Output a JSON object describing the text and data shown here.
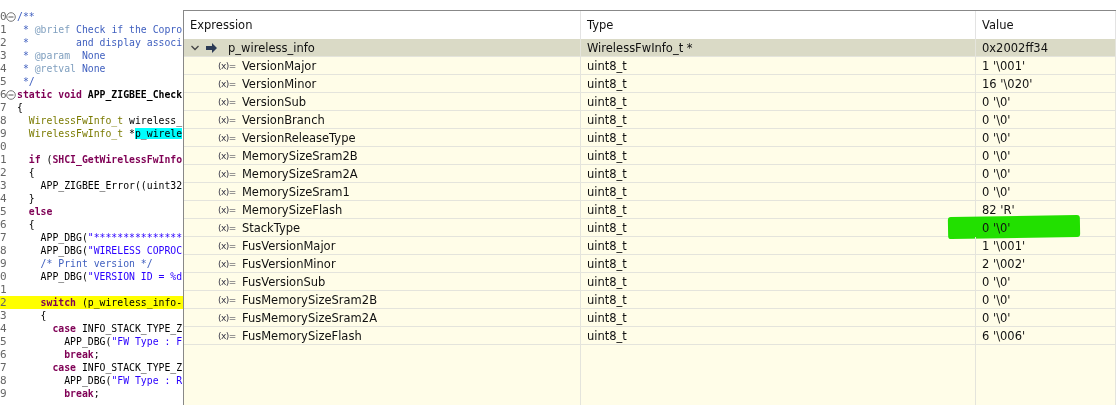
{
  "editor": {
    "lines": [
      {
        "number": "0",
        "folded": true,
        "highlighted": false,
        "segments": [
          {
            "kind": "comment",
            "text": "/**"
          }
        ]
      },
      {
        "number": "1",
        "folded": false,
        "highlighted": false,
        "segments": [
          {
            "kind": "comment",
            "text": " * "
          },
          {
            "kind": "tag",
            "text": "@brief"
          },
          {
            "kind": "comment",
            "text": " Check if the Copro"
          }
        ]
      },
      {
        "number": "2",
        "folded": false,
        "highlighted": false,
        "segments": [
          {
            "kind": "comment",
            "text": " *        and display associ"
          }
        ]
      },
      {
        "number": "3",
        "folded": false,
        "highlighted": false,
        "segments": [
          {
            "kind": "comment",
            "text": " * "
          },
          {
            "kind": "tag",
            "text": "@param"
          },
          {
            "kind": "comment",
            "text": "  None"
          }
        ]
      },
      {
        "number": "4",
        "folded": false,
        "highlighted": false,
        "segments": [
          {
            "kind": "comment",
            "text": " * "
          },
          {
            "kind": "tag",
            "text": "@retval"
          },
          {
            "kind": "comment",
            "text": " None"
          }
        ]
      },
      {
        "number": "5",
        "folded": false,
        "highlighted": false,
        "segments": [
          {
            "kind": "comment",
            "text": " */"
          }
        ]
      },
      {
        "number": "6",
        "folded": true,
        "highlighted": false,
        "segments": [
          {
            "kind": "keyword",
            "text": "static void "
          },
          {
            "kind": "function",
            "text": "APP_ZIGBEE_Check"
          }
        ]
      },
      {
        "number": "7",
        "folded": false,
        "highlighted": false,
        "segments": [
          {
            "kind": "plain",
            "text": "{"
          }
        ]
      },
      {
        "number": "8",
        "folded": false,
        "highlighted": false,
        "segments": [
          {
            "kind": "type",
            "text": "  WirelessFwInfo_t"
          },
          {
            "kind": "plain",
            "text": " wireless_"
          }
        ]
      },
      {
        "number": "9",
        "folded": false,
        "highlighted": false,
        "segments": [
          {
            "kind": "type",
            "text": "  WirelessFwInfo_t"
          },
          {
            "kind": "plain",
            "text": " *"
          },
          {
            "kind": "match",
            "text": "p_wirele"
          }
        ]
      },
      {
        "number": "0",
        "folded": false,
        "highlighted": false
      },
      {
        "number": "1",
        "folded": false,
        "highlighted": false,
        "segments": [
          {
            "kind": "keyword",
            "text": "  if"
          },
          {
            "kind": "plain",
            "text": " ("
          },
          {
            "kind": "keyword",
            "text": "SHCI_GetWirelessFwInfo"
          }
        ]
      },
      {
        "number": "2",
        "folded": false,
        "highlighted": false,
        "segments": [
          {
            "kind": "plain",
            "text": "  {"
          }
        ]
      },
      {
        "number": "3",
        "folded": false,
        "highlighted": false,
        "segments": [
          {
            "kind": "plain",
            "text": "    APP_ZIGBEE_Error((uint32"
          }
        ]
      },
      {
        "number": "4",
        "folded": false,
        "highlighted": false,
        "segments": [
          {
            "kind": "plain",
            "text": "  }"
          }
        ]
      },
      {
        "number": "5",
        "folded": false,
        "highlighted": false,
        "segments": [
          {
            "kind": "keyword",
            "text": "  else"
          }
        ]
      },
      {
        "number": "6",
        "folded": false,
        "highlighted": false,
        "segments": [
          {
            "kind": "plain",
            "text": "  {"
          }
        ]
      },
      {
        "number": "7",
        "folded": false,
        "highlighted": false,
        "segments": [
          {
            "kind": "plain",
            "text": "    APP_DBG("
          },
          {
            "kind": "string",
            "text": "\"***************"
          }
        ]
      },
      {
        "number": "8",
        "folded": false,
        "highlighted": false,
        "segments": [
          {
            "kind": "plain",
            "text": "    APP_DBG("
          },
          {
            "kind": "string",
            "text": "\"WIRELESS COPROC"
          }
        ]
      },
      {
        "number": "9",
        "folded": false,
        "highlighted": false,
        "segments": [
          {
            "kind": "comment",
            "text": "    /* Print version */"
          }
        ]
      },
      {
        "number": "0",
        "folded": false,
        "highlighted": false,
        "segments": [
          {
            "kind": "plain",
            "text": "    APP_DBG("
          },
          {
            "kind": "string",
            "text": "\"VERSION ID = %d"
          }
        ]
      },
      {
        "number": "1",
        "folded": false,
        "highlighted": false
      },
      {
        "number": "2",
        "folded": false,
        "highlighted": true,
        "segments": [
          {
            "kind": "keyword",
            "text": "    switch"
          },
          {
            "kind": "plain",
            "text": " (p_wireless_info-"
          }
        ]
      },
      {
        "number": "3",
        "folded": false,
        "highlighted": false,
        "segments": [
          {
            "kind": "plain",
            "text": "    {"
          }
        ]
      },
      {
        "number": "4",
        "folded": false,
        "highlighted": false,
        "segments": [
          {
            "kind": "keyword",
            "text": "      case"
          },
          {
            "kind": "plain",
            "text": " INFO_STACK_TYPE_Z"
          }
        ]
      },
      {
        "number": "5",
        "folded": false,
        "highlighted": false,
        "segments": [
          {
            "kind": "plain",
            "text": "        APP_DBG("
          },
          {
            "kind": "string",
            "text": "\"FW Type : F"
          }
        ]
      },
      {
        "number": "6",
        "folded": false,
        "highlighted": false,
        "segments": [
          {
            "kind": "keyword",
            "text": "        break"
          },
          {
            "kind": "plain",
            "text": ";"
          }
        ]
      },
      {
        "number": "7",
        "folded": false,
        "highlighted": false,
        "segments": [
          {
            "kind": "keyword",
            "text": "      case"
          },
          {
            "kind": "plain",
            "text": " INFO_STACK_TYPE_Z"
          }
        ]
      },
      {
        "number": "8",
        "folded": false,
        "highlighted": false,
        "segments": [
          {
            "kind": "plain",
            "text": "        APP_DBG("
          },
          {
            "kind": "string",
            "text": "\"FW Type : R"
          }
        ]
      },
      {
        "number": "9",
        "folded": false,
        "highlighted": false,
        "segments": [
          {
            "kind": "keyword",
            "text": "        break"
          },
          {
            "kind": "plain",
            "text": ";"
          }
        ]
      }
    ]
  },
  "expressions": {
    "columns": [
      "Expression",
      "Type",
      "Value"
    ],
    "rows": [
      {
        "expression": "p_wireless_info",
        "type": "WirelessFwInfo_t *",
        "value": "0x2002ff34",
        "selected": true,
        "expanded": true,
        "marked": false,
        "children": [
          {
            "icon_text": "(x)=",
            "expression": "VersionMajor",
            "type": "uint8_t",
            "value": "1 '\\001'",
            "selected": false,
            "marked": false
          },
          {
            "icon_text": "(x)=",
            "expression": "VersionMinor",
            "type": "uint8_t",
            "value": "16 '\\020'",
            "selected": false,
            "marked": false
          },
          {
            "icon_text": "(x)=",
            "expression": "VersionSub",
            "type": "uint8_t",
            "value": "0 '\\0'",
            "selected": false,
            "marked": false
          },
          {
            "icon_text": "(x)=",
            "expression": "VersionBranch",
            "type": "uint8_t",
            "value": "0 '\\0'",
            "selected": false,
            "marked": false
          },
          {
            "icon_text": "(x)=",
            "expression": "VersionReleaseType",
            "type": "uint8_t",
            "value": "0 '\\0'",
            "selected": false,
            "marked": false
          },
          {
            "icon_text": "(x)=",
            "expression": "MemorySizeSram2B",
            "type": "uint8_t",
            "value": "0 '\\0'",
            "selected": false,
            "marked": false
          },
          {
            "icon_text": "(x)=",
            "expression": "MemorySizeSram2A",
            "type": "uint8_t",
            "value": "0 '\\0'",
            "selected": false,
            "marked": false
          },
          {
            "icon_text": "(x)=",
            "expression": "MemorySizeSram1",
            "type": "uint8_t",
            "value": "0 '\\0'",
            "selected": false,
            "marked": false
          },
          {
            "icon_text": "(x)=",
            "expression": "MemorySizeFlash",
            "type": "uint8_t",
            "value": "82 'R'",
            "selected": false,
            "marked": false
          },
          {
            "icon_text": "(x)=",
            "expression": "StackType",
            "type": "uint8_t",
            "value": "0 '\\0'",
            "selected": false,
            "marked": true
          },
          {
            "icon_text": "(x)=",
            "expression": "FusVersionMajor",
            "type": "uint8_t",
            "value": "1 '\\001'",
            "selected": false,
            "marked": false
          },
          {
            "icon_text": "(x)=",
            "expression": "FusVersionMinor",
            "type": "uint8_t",
            "value": "2 '\\002'",
            "selected": false,
            "marked": false
          },
          {
            "icon_text": "(x)=",
            "expression": "FusVersionSub",
            "type": "uint8_t",
            "value": "0 '\\0'",
            "selected": false,
            "marked": false
          },
          {
            "icon_text": "(x)=",
            "expression": "FusMemorySizeSram2B",
            "type": "uint8_t",
            "value": "0 '\\0'",
            "selected": false,
            "marked": false
          },
          {
            "icon_text": "(x)=",
            "expression": "FusMemorySizeSram2A",
            "type": "uint8_t",
            "value": "0 '\\0'",
            "selected": false,
            "marked": false
          },
          {
            "icon_text": "(x)=",
            "expression": "FusMemorySizeFlash",
            "type": "uint8_t",
            "value": "6 '\\006'",
            "selected": false,
            "marked": false
          }
        ]
      }
    ]
  }
}
